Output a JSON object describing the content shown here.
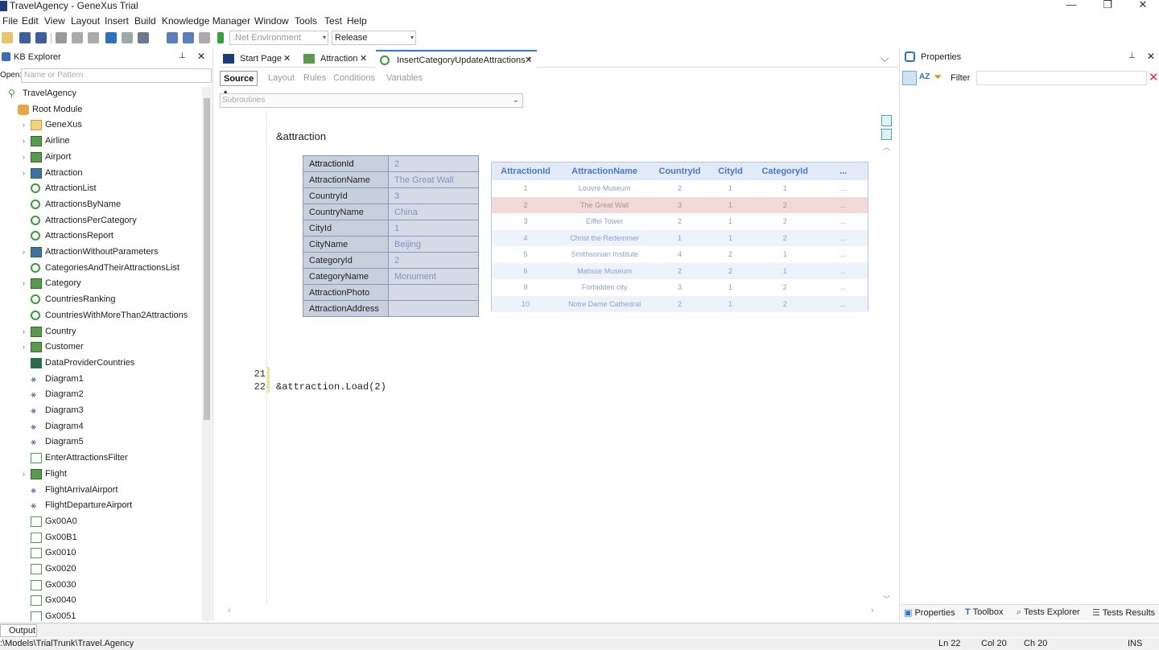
{
  "window": {
    "title": "TravelAgency - GeneXus Trial",
    "minimize": "—",
    "restore": "❐",
    "close": "✕"
  },
  "menu": [
    "File",
    "Edit",
    "View",
    "Layout",
    "Insert",
    "Build",
    "Knowledge Manager",
    "Window",
    "Tools",
    "Test",
    "Help"
  ],
  "toolbar": {
    "environment": ".Net Environment",
    "configuration": "Release"
  },
  "kb_explorer": {
    "title": "KB Explorer",
    "open_label": "Open:",
    "open_placeholder": "Name or Pattern",
    "tree": [
      {
        "label": "TravelAgency",
        "icon": "kb-icon",
        "level": 0
      },
      {
        "label": "Root Module",
        "icon": "module-icon",
        "level": 1
      },
      {
        "label": "GeneXus",
        "icon": "folder-icon",
        "level": 2
      },
      {
        "label": "Airline",
        "icon": "transaction-icon",
        "level": 2
      },
      {
        "label": "Airport",
        "icon": "transaction-icon",
        "level": 2
      },
      {
        "label": "Attraction",
        "icon": "transaction-icon",
        "level": 2
      },
      {
        "label": "AttractionList",
        "icon": "procedure-icon",
        "level": 2
      },
      {
        "label": "AttractionsByName",
        "icon": "procedure-icon",
        "level": 2
      },
      {
        "label": "AttractionsPerCategory",
        "icon": "procedure-icon",
        "level": 2
      },
      {
        "label": "AttractionsReport",
        "icon": "procedure-icon",
        "level": 2
      },
      {
        "label": "AttractionWithoutParameters",
        "icon": "transaction-icon",
        "level": 2
      },
      {
        "label": "CategoriesAndTheirAttractionsList",
        "icon": "procedure-icon",
        "level": 2
      },
      {
        "label": "Category",
        "icon": "transaction-icon",
        "level": 2
      },
      {
        "label": "CountriesRanking",
        "icon": "procedure-icon",
        "level": 2
      },
      {
        "label": "CountriesWithMoreThan2Attractions",
        "icon": "procedure-icon",
        "level": 2
      },
      {
        "label": "Country",
        "icon": "transaction-icon",
        "level": 2
      },
      {
        "label": "Customer",
        "icon": "transaction-icon",
        "level": 2
      },
      {
        "label": "DataProviderCountries",
        "icon": "dataprovider-icon",
        "level": 2
      },
      {
        "label": "Diagram1",
        "icon": "diagram-icon",
        "level": 2
      },
      {
        "label": "Diagram2",
        "icon": "diagram-icon",
        "level": 2
      },
      {
        "label": "Diagram3",
        "icon": "diagram-icon",
        "level": 2
      },
      {
        "label": "Diagram4",
        "icon": "diagram-icon",
        "level": 2
      },
      {
        "label": "Diagram5",
        "icon": "diagram-icon",
        "level": 2
      },
      {
        "label": "EnterAttractionsFilter",
        "icon": "webpanel-icon",
        "level": 2
      },
      {
        "label": "Flight",
        "icon": "transaction-icon",
        "level": 2
      },
      {
        "label": "FlightArrivalAirport",
        "icon": "diagram-icon",
        "level": 2
      },
      {
        "label": "FlightDepartureAirport",
        "icon": "diagram-icon",
        "level": 2
      },
      {
        "label": "Gx00A0",
        "icon": "webpanel-icon",
        "level": 2
      },
      {
        "label": "Gx00B1",
        "icon": "webpanel-icon",
        "level": 2
      },
      {
        "label": "Gx0010",
        "icon": "webpanel-icon",
        "level": 2
      },
      {
        "label": "Gx0020",
        "icon": "webpanel-icon",
        "level": 2
      },
      {
        "label": "Gx0030",
        "icon": "webpanel-icon",
        "level": 2
      },
      {
        "label": "Gx0040",
        "icon": "webpanel-icon",
        "level": 2
      },
      {
        "label": "Gx0051",
        "icon": "webpanel-icon",
        "level": 2
      }
    ]
  },
  "doc_tabs": [
    {
      "label": "Start Page"
    },
    {
      "label": "Attraction"
    },
    {
      "label": "InsertCategoryUpdateAttractions *"
    }
  ],
  "sub_tabs": [
    "Source *",
    "Layout",
    "Rules",
    "Conditions",
    "Variables"
  ],
  "subroutines_placeholder": "Subroutines",
  "editor": {
    "variable_title": "&attraction",
    "sdt": [
      {
        "key": "AttractionId",
        "value": "2"
      },
      {
        "key": "AttractionName",
        "value": "The Great Wall"
      },
      {
        "key": "CountryId",
        "value": "3"
      },
      {
        "key": "CountryName",
        "value": "China"
      },
      {
        "key": "CityId",
        "value": "1"
      },
      {
        "key": "CityName",
        "value": "Beijing"
      },
      {
        "key": "CategoryId",
        "value": "2"
      },
      {
        "key": "CategoryName",
        "value": "Monument"
      },
      {
        "key": "AttractionPhoto",
        "value": ""
      },
      {
        "key": "AttractionAddress",
        "value": ""
      }
    ],
    "grid": {
      "headers": [
        "AttractionId",
        "AttractionName",
        "CountryId",
        "CityId",
        "CategoryId",
        "..."
      ],
      "rows": [
        [
          "1",
          "Louvre Museum",
          "2",
          "1",
          "1",
          "..."
        ],
        [
          "2",
          "The Great Wall",
          "3",
          "1",
          "2",
          "..."
        ],
        [
          "3",
          "Eiffel Tower",
          "2",
          "1",
          "2",
          "..."
        ],
        [
          "4",
          "Christ the Redemmer",
          "1",
          "1",
          "2",
          "..."
        ],
        [
          "5",
          "Smithsonian Institute",
          "4",
          "2",
          "1",
          "..."
        ],
        [
          "6",
          "Matisse Museum",
          "2",
          "2",
          "1",
          "..."
        ],
        [
          "9",
          "Forbidden city",
          "3",
          "1",
          "2",
          "..."
        ],
        [
          "10",
          "Notre Dame Cathedral",
          "2",
          "1",
          "2",
          "..."
        ]
      ]
    },
    "lines": [
      {
        "num": "21",
        "code": ""
      },
      {
        "num": "22",
        "code": "&attraction.Load(2)"
      }
    ]
  },
  "properties": {
    "title": "Properties",
    "filter_label": "Filter"
  },
  "bottom_tabs": [
    "Properties",
    "Toolbox",
    "Tests Explorer",
    "Tests Results"
  ],
  "output_tab": "Output",
  "status": {
    "path": ":\\Models\\TrialTrunk\\Travel.Agency",
    "ln": "Ln 22",
    "col": "Col 20",
    "ch": "Ch 20",
    "mode": "INS"
  }
}
